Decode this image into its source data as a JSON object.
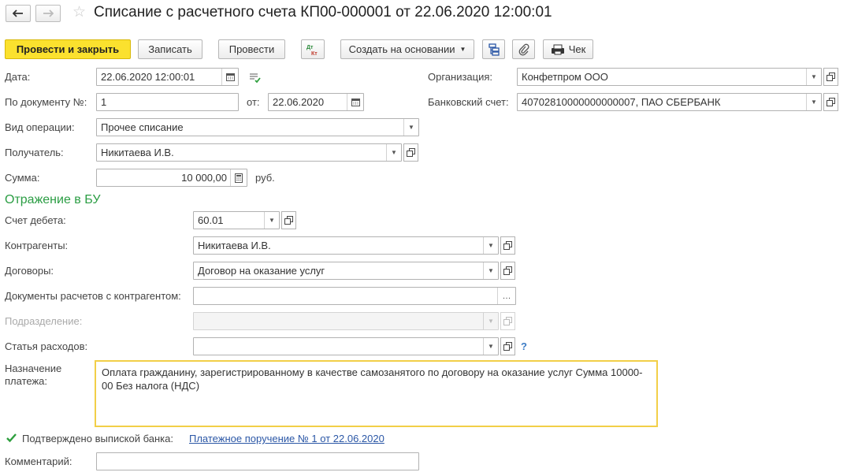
{
  "header": {
    "back_icon": "arrow-left-icon",
    "forward_icon": "arrow-right-icon",
    "title": "Списание с расчетного счета КП00-000001 от 22.06.2020 12:00:01"
  },
  "toolbar": {
    "post_close": "Провести и закрыть",
    "save": "Записать",
    "post": "Провести",
    "dt_kt_icon": "debit-credit-icon",
    "create_based": "Создать на основании",
    "structure_icon": "structure-icon",
    "attach_icon": "paperclip-icon",
    "receipt": "Чек"
  },
  "form": {
    "date_label": "Дата:",
    "date_value": "22.06.2020 12:00:01",
    "doc_no_label": "По документу №:",
    "doc_no_value": "1",
    "from_label": "от:",
    "from_value": "22.06.2020",
    "operation_label": "Вид операции:",
    "operation_value": "Прочее списание",
    "recipient_label": "Получатель:",
    "recipient_value": "Никитаева И.В.",
    "sum_label": "Сумма:",
    "sum_value": "10 000,00",
    "currency": "руб.",
    "org_label": "Организация:",
    "org_value": "Конфетпром ООО",
    "bank_label": "Банковский счет:",
    "bank_value": "40702810000000000007, ПАО СБЕРБАНК"
  },
  "bu": {
    "section_title": "Отражение в БУ",
    "debit_label": "Счет дебета:",
    "debit_value": "60.01",
    "counterparty_label": "Контрагенты:",
    "counterparty_value": "Никитаева И.В.",
    "contract_label": "Договоры:",
    "contract_value": "Договор на оказание услуг",
    "settlement_docs_label": "Документы расчетов с контрагентом:",
    "settlement_docs_value": "",
    "division_label": "Подразделение:",
    "division_value": "",
    "expense_label": "Статья расходов:",
    "expense_value": "",
    "help_mark": "?"
  },
  "payment": {
    "purpose_label": "Назначение платежа:",
    "purpose_value": "Оплата гражданину, зарегистрированному в качестве самозанятого по договору на оказание услуг Сумма 10000-00 Без налога (НДС)",
    "confirmed_label": "Подтверждено выпиской банка:",
    "confirmed_checked": true,
    "order_link": "Платежное поручение № 1 от 22.06.2020",
    "comment_label": "Комментарий:",
    "comment_value": ""
  }
}
